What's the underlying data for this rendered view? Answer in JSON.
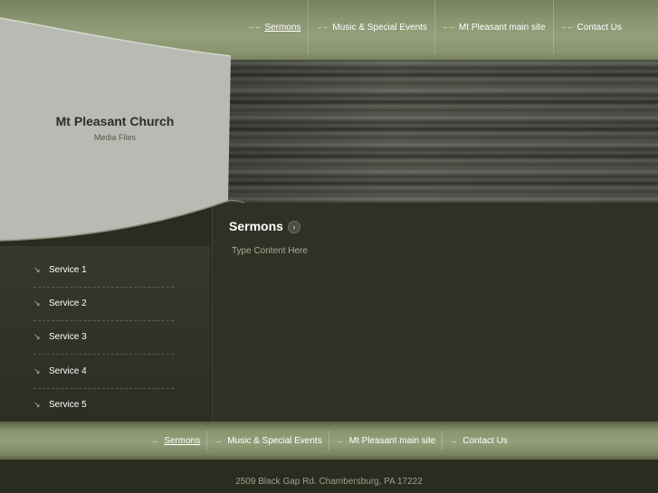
{
  "site": {
    "title": "Mt Pleasant Church",
    "subtitle": "Media Files"
  },
  "top_nav": [
    {
      "label": "Sermons",
      "active": true
    },
    {
      "label": "Music & Special Events",
      "active": false
    },
    {
      "label": "Mt Pleasant main site",
      "active": false
    },
    {
      "label": "Contact Us",
      "active": false
    }
  ],
  "sidebar": {
    "items": [
      {
        "label": "Service 1"
      },
      {
        "label": "Service 2"
      },
      {
        "label": "Service 3"
      },
      {
        "label": "Service 4"
      },
      {
        "label": "Service 5"
      }
    ]
  },
  "content": {
    "title": "Sermons",
    "body": "Type Content Here"
  },
  "bottom_nav": [
    {
      "label": "Sermons",
      "active": true
    },
    {
      "label": "Music & Special Events",
      "active": false
    },
    {
      "label": "Mt Pleasant main site",
      "active": false
    },
    {
      "label": "Contact Us",
      "active": false
    }
  ],
  "footer": {
    "address": "2509 Black Gap Rd. Chambersburg, PA 17222"
  },
  "colors": {
    "nav_band": "#8a946e",
    "panel_grey": "#b8bbb3",
    "background": "#2a2c20"
  }
}
